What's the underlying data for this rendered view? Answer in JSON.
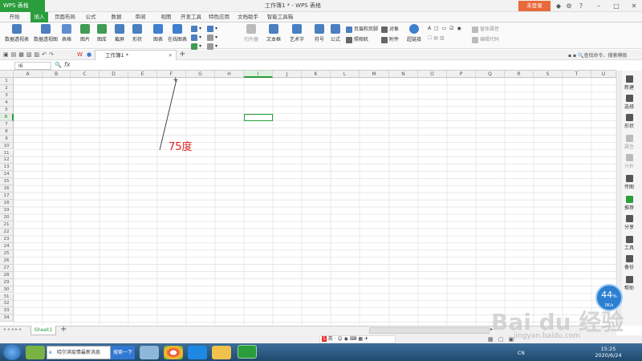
{
  "app": {
    "logo": "WPS 表格",
    "window_title": "工作簿1 * - WPS 表格",
    "login": "未登录"
  },
  "menu_tabs": [
    "开始",
    "插入",
    "页面布局",
    "公式",
    "数据",
    "审阅",
    "视图",
    "开发工具",
    "特色应用",
    "文档助手",
    "智能工具箱"
  ],
  "active_tab": "插入",
  "ribbon": {
    "large": [
      "数据透视表",
      "数据透视图",
      "表格",
      "图片",
      "图库",
      "截屏",
      "形状",
      "图表",
      "在线图表",
      "切片器",
      "文本框",
      "艺术字",
      "符号",
      "公式",
      "超链接"
    ],
    "small": [
      "页眉和页脚",
      "对象",
      "照相机",
      "附件",
      "窗体属性",
      "编辑代码"
    ]
  },
  "doc_tab": "工作簿1 *",
  "search_hint": "查找命令、搜索模板",
  "namebox": "I6",
  "fx": "fx",
  "columns": [
    "A",
    "B",
    "C",
    "D",
    "E",
    "F",
    "G",
    "H",
    "I",
    "J",
    "K",
    "L",
    "M",
    "N",
    "O",
    "P",
    "Q",
    "R",
    "S",
    "T",
    "U"
  ],
  "rows": [
    "1",
    "2",
    "3",
    "4",
    "5",
    "6",
    "7",
    "8",
    "9",
    "10",
    "11",
    "12",
    "13",
    "14",
    "15",
    "16",
    "17",
    "18",
    "19",
    "20",
    "21",
    "22",
    "23",
    "24",
    "25",
    "26",
    "27",
    "28",
    "29",
    "30",
    "31",
    "32",
    "33",
    "34"
  ],
  "selected_cell": "I6",
  "annotation": "75度",
  "sidebar": [
    "新建",
    "选择",
    "形状",
    "属性",
    "分析",
    "传图",
    "推荐",
    "分享",
    "工具",
    "备份",
    "帮助"
  ],
  "sheet_tab": "Sheet1",
  "speed": {
    "percent": "44",
    "unit": "%",
    "rate": "0K/s"
  },
  "taskbar": {
    "ie_item": "哈尔滨疫情最新消息",
    "search_btn": "搜索一下",
    "time": "15:25",
    "date": "2020/6/24",
    "lang": "CN"
  },
  "ime_label": "英",
  "watermark": "Bai du 经验",
  "watermark_url": "jingyan.baidu.com",
  "colors": {
    "accent": "#2a9d3c",
    "login": "#e8693c",
    "annotation": "#e02020"
  }
}
